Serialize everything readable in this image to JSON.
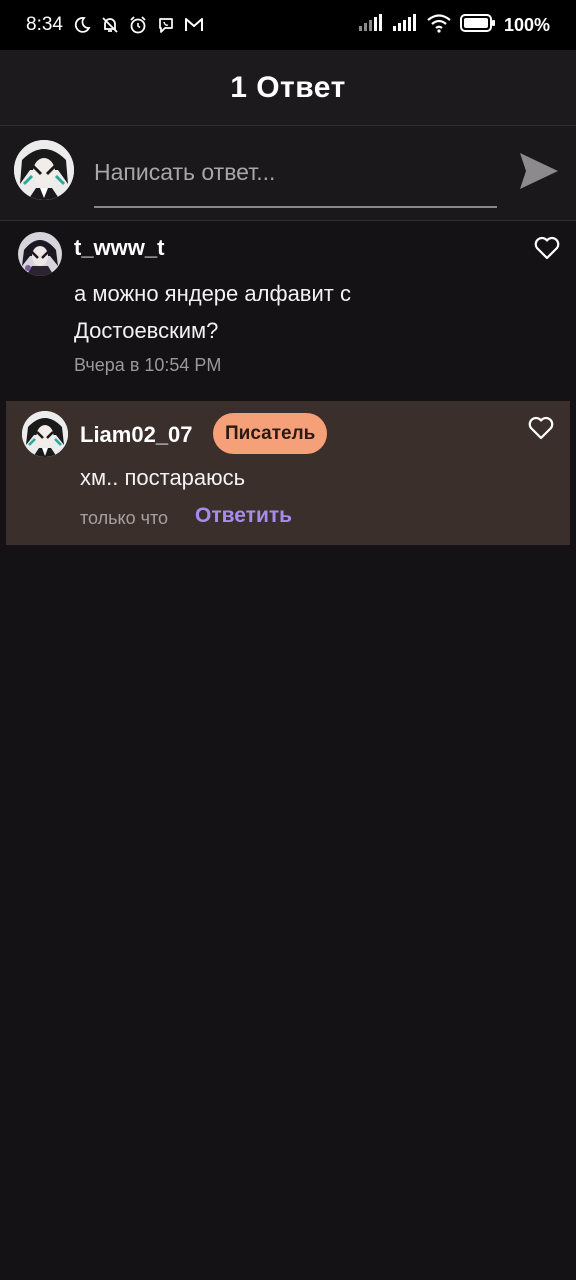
{
  "status_bar": {
    "time": "8:34",
    "battery": "100%",
    "icons_left": [
      "moon-icon",
      "bell-off-icon",
      "alarm-icon",
      "viber-icon",
      "gmail-icon"
    ],
    "icons_right": [
      "signal-icon",
      "signal-icon",
      "wifi-icon",
      "battery-icon"
    ]
  },
  "header": {
    "title": "1 Ответ"
  },
  "composer": {
    "placeholder": "Написать ответ...",
    "send_icon": "send-icon"
  },
  "comment": {
    "username": "t_www_t",
    "text": "а можно яндере алфавит с Достоевским?",
    "time": "Вчера в 10:54 PM",
    "like_icon": "heart-outline-icon"
  },
  "reply": {
    "username": "Liam02_07",
    "badge": "Писатель",
    "text": "хм.. постараюсь",
    "time": "только что",
    "reply_label": "Ответить",
    "like_icon": "heart-outline-icon"
  },
  "colors": {
    "background": "#141214",
    "reply_highlight": "#3b2f2b",
    "badge": "#f5a078",
    "accent": "#a98bf0"
  }
}
